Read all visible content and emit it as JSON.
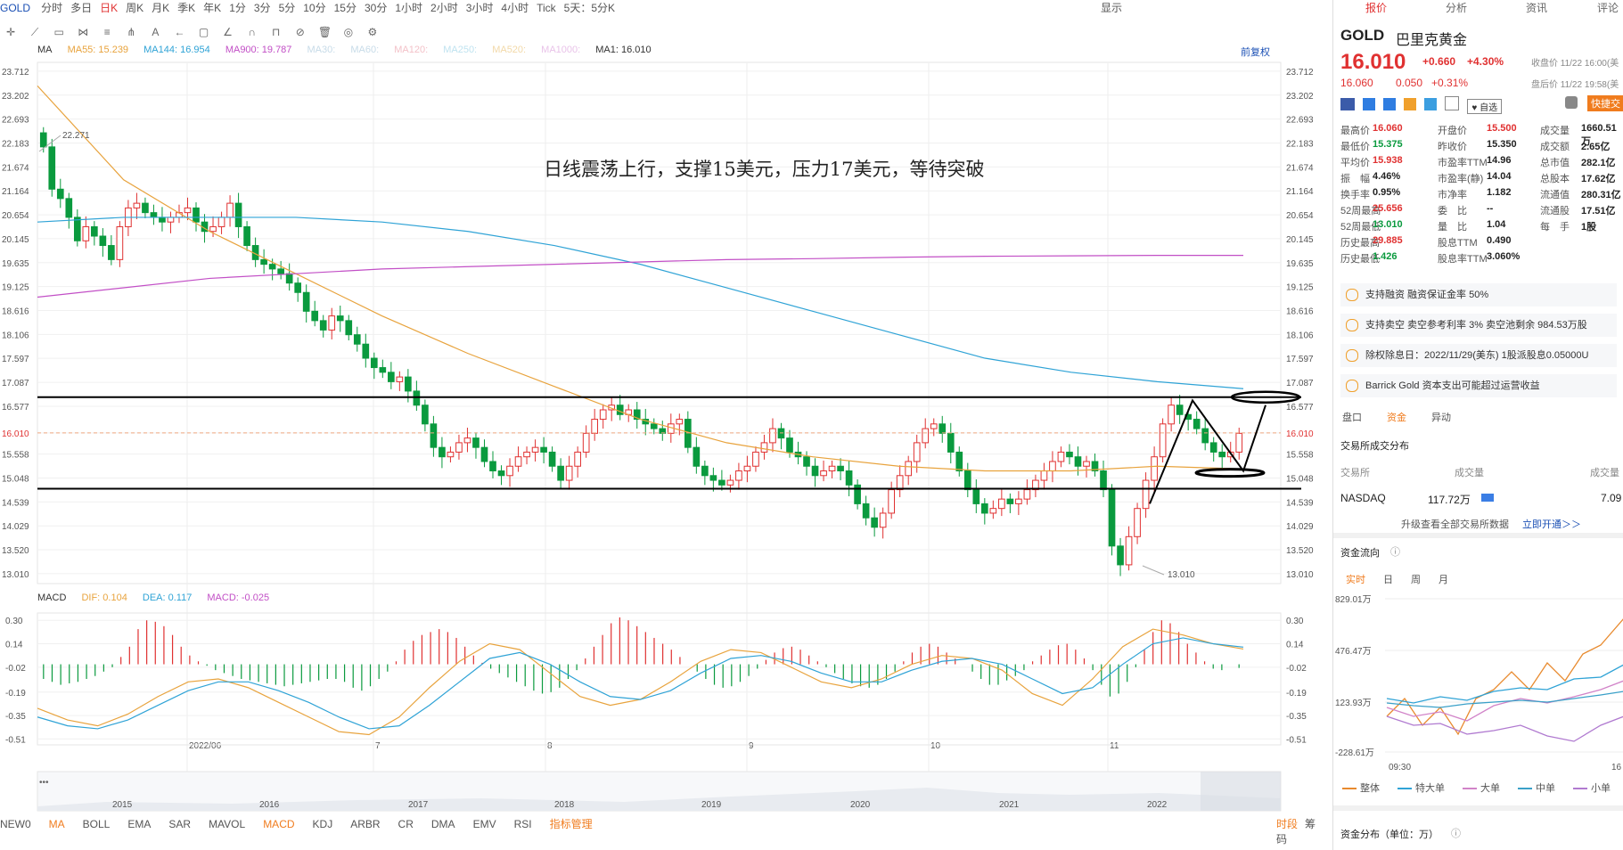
{
  "topbar": {
    "symbol": "GOLD",
    "periods": [
      "分时",
      "多日",
      "日K",
      "周K",
      "月K",
      "季K",
      "年K",
      "1分",
      "3分",
      "5分",
      "10分",
      "15分",
      "30分",
      "1小时",
      "2小时",
      "3小时",
      "4小时",
      "Tick",
      "5天：5分K"
    ],
    "active_period": "日K",
    "right_label": "显示"
  },
  "ma_legend": {
    "ma": "MA",
    "ma55": "MA55: 15.239",
    "ma144": "MA144: 16.954",
    "ma900": "MA900: 19.787",
    "ma30": "MA30:",
    "ma60": "MA60:",
    "ma120": "MA120:",
    "ma250": "MA250:",
    "ma520": "MA520:",
    "ma1000": "MA1000:",
    "ma1": "MA1: 16.010",
    "adjust": "前复权"
  },
  "macd_legend": {
    "name": "MACD",
    "dif": "DIF: 0.104",
    "dea": "DEA: 0.117",
    "macd": "MACD: -0.025"
  },
  "annotation": "日线震荡上行，支撑15美元，压力17美元，等待突破",
  "chart_data": [
    {
      "type": "line",
      "title": "",
      "price_ticks": [
        "23.712",
        "23.202",
        "22.693",
        "22.183",
        "21.674",
        "21.164",
        "20.654",
        "20.145",
        "19.635",
        "19.125",
        "18.616",
        "18.106",
        "17.597",
        "17.087",
        "16.577",
        "16.010",
        "15.558",
        "15.048",
        "14.539",
        "14.029",
        "13.520",
        "13.010"
      ],
      "ylim": [
        12.8,
        23.9
      ],
      "x_labels": [
        "2022/06",
        "7",
        "8",
        "9",
        "10",
        "11"
      ],
      "high_label": "22.271",
      "low_label": "13.010",
      "current_price": "16.010",
      "closes": [
        22.1,
        21.2,
        21.0,
        20.6,
        20.1,
        20.4,
        20.2,
        20.0,
        19.7,
        20.4,
        20.8,
        20.9,
        20.7,
        20.6,
        20.5,
        20.6,
        20.7,
        20.8,
        20.5,
        20.3,
        20.4,
        20.6,
        20.9,
        20.4,
        20.0,
        19.7,
        19.6,
        19.5,
        19.4,
        19.2,
        19.0,
        18.6,
        18.4,
        18.2,
        18.5,
        18.4,
        18.1,
        17.9,
        17.6,
        17.4,
        17.3,
        17.1,
        17.2,
        16.9,
        16.6,
        16.2,
        15.7,
        15.5,
        15.6,
        15.8,
        15.9,
        15.7,
        15.4,
        15.2,
        15.1,
        15.3,
        15.5,
        15.6,
        15.7,
        15.6,
        15.3,
        15.0,
        15.3,
        15.6,
        16.0,
        16.3,
        16.5,
        16.6,
        16.4,
        16.5,
        16.3,
        16.2,
        16.1,
        16.0,
        16.2,
        16.3,
        15.7,
        15.3,
        15.1,
        15.0,
        14.9,
        15.0,
        15.2,
        15.3,
        15.6,
        15.8,
        16.1,
        15.9,
        15.6,
        15.5,
        15.3,
        15.1,
        15.2,
        15.3,
        15.2,
        14.9,
        14.5,
        14.2,
        14.0,
        14.3,
        14.8,
        15.1,
        15.4,
        15.8,
        16.1,
        16.2,
        16.0,
        15.6,
        15.2,
        14.8,
        14.5,
        14.3,
        14.4,
        14.6,
        14.5,
        14.6,
        14.8,
        15.0,
        15.2,
        15.4,
        15.6,
        15.5,
        15.3,
        15.4,
        15.2,
        14.8,
        13.6,
        13.2,
        13.8,
        14.4,
        15.0,
        15.5,
        16.2,
        16.6,
        16.4,
        16.3,
        16.1,
        15.8,
        15.6,
        15.5,
        15.6,
        16.0
      ],
      "series": [
        {
          "name": "MA55",
          "values": [
            23.4,
            21.4,
            20.3,
            19.4,
            18.5,
            17.7,
            17.0,
            16.3,
            15.8,
            15.5,
            15.3,
            15.2,
            15.2,
            15.3,
            15.24
          ]
        },
        {
          "name": "MA144",
          "values": [
            20.5,
            20.6,
            20.6,
            20.6,
            20.5,
            20.3,
            20.0,
            19.6,
            19.1,
            18.6,
            18.1,
            17.6,
            17.3,
            17.1,
            16.95
          ]
        },
        {
          "name": "MA900",
          "values": [
            18.9,
            19.1,
            19.3,
            19.4,
            19.5,
            19.55,
            19.6,
            19.65,
            19.7,
            19.72,
            19.75,
            19.77,
            19.78,
            19.79,
            19.79
          ]
        }
      ]
    },
    {
      "type": "bar",
      "title": "",
      "ylim": [
        -0.55,
        0.35
      ],
      "y_ticks": [
        "0.30",
        "0.14",
        "-0.02",
        "-0.19",
        "-0.35",
        "-0.51"
      ],
      "macd_hist": [
        -0.1,
        -0.12,
        -0.14,
        -0.13,
        -0.12,
        -0.1,
        -0.08,
        -0.05,
        -0.02,
        0.05,
        0.12,
        0.24,
        0.3,
        0.29,
        0.26,
        0.2,
        0.12,
        0.06,
        0.02,
        -0.01,
        -0.04,
        -0.06,
        -0.08,
        -0.1,
        -0.11,
        -0.12,
        -0.13,
        -0.14,
        -0.15,
        -0.14,
        -0.13,
        -0.12,
        -0.11,
        -0.1,
        -0.1,
        -0.12,
        -0.16,
        -0.18,
        -0.15,
        -0.1,
        -0.05,
        0.02,
        0.1,
        0.16,
        0.2,
        0.22,
        0.24,
        0.22,
        0.18,
        0.12,
        0.06,
        0.01,
        -0.03,
        -0.06,
        -0.09,
        -0.12,
        -0.15,
        -0.18,
        -0.2,
        -0.19,
        -0.16,
        -0.1,
        -0.04,
        0.04,
        0.12,
        0.2,
        0.28,
        0.32,
        0.3,
        0.26,
        0.22,
        0.18,
        0.14,
        0.1,
        0.05,
        0.0,
        -0.05,
        -0.1,
        -0.14,
        -0.16,
        -0.15,
        -0.12,
        -0.08,
        -0.03,
        0.03,
        0.08,
        0.11,
        0.12,
        0.1,
        0.06,
        0.02,
        -0.02,
        -0.06,
        -0.1,
        -0.13,
        -0.15,
        -0.16,
        -0.14,
        -0.1,
        -0.05,
        0.02,
        0.08,
        0.12,
        0.14,
        0.12,
        0.08,
        0.04,
        0.0,
        -0.05,
        -0.1,
        -0.14,
        -0.14,
        -0.11,
        -0.08,
        -0.04,
        0.02,
        0.06,
        0.1,
        0.13,
        0.14,
        0.1,
        0.04,
        -0.04,
        -0.14,
        -0.22,
        -0.2,
        -0.12,
        -0.02,
        0.1,
        0.22,
        0.3,
        0.28,
        0.22,
        0.14,
        0.08,
        0.02,
        -0.03,
        -0.04,
        0.0,
        -0.025
      ],
      "series": [
        {
          "name": "DIF",
          "values": [
            -0.3,
            -0.38,
            -0.42,
            -0.34,
            -0.22,
            -0.12,
            -0.1,
            -0.16,
            -0.26,
            -0.36,
            -0.46,
            -0.48,
            -0.36,
            -0.16,
            0.02,
            0.14,
            0.1,
            -0.06,
            -0.22,
            -0.28,
            -0.24,
            -0.12,
            0.02,
            0.1,
            0.08,
            -0.02,
            -0.12,
            -0.16,
            -0.1,
            0.0,
            0.06,
            0.04,
            -0.04,
            -0.2,
            -0.28,
            -0.1,
            0.12,
            0.24,
            0.2,
            0.14,
            0.104
          ]
        },
        {
          "name": "DEA",
          "values": [
            -0.36,
            -0.42,
            -0.44,
            -0.38,
            -0.28,
            -0.18,
            -0.12,
            -0.12,
            -0.18,
            -0.26,
            -0.36,
            -0.44,
            -0.42,
            -0.28,
            -0.12,
            0.04,
            0.08,
            0.0,
            -0.12,
            -0.22,
            -0.24,
            -0.18,
            -0.06,
            0.04,
            0.06,
            0.02,
            -0.06,
            -0.12,
            -0.12,
            -0.04,
            0.02,
            0.04,
            0.0,
            -0.1,
            -0.2,
            -0.16,
            0.0,
            0.14,
            0.18,
            0.14,
            0.117
          ]
        }
      ]
    }
  ],
  "overview": {
    "years": [
      "2015",
      "2016",
      "2017",
      "2018",
      "2019",
      "2020",
      "2021",
      "2022"
    ]
  },
  "indicators": [
    "NEW0",
    "MA",
    "BOLL",
    "EMA",
    "SAR",
    "MAVOL",
    "MACD",
    "KDJ",
    "ARBR",
    "CR",
    "DMA",
    "EMV",
    "RSI",
    "指标管理"
  ],
  "indicator_active": "MACD",
  "indicators_right": [
    "时段",
    "筹码"
  ],
  "right_panel": {
    "tabs": [
      "报价",
      "分析",
      "资讯",
      "评论"
    ],
    "symbol": "GOLD",
    "name": "巴里克黄金",
    "price": "16.010",
    "change": "+0.660",
    "pct": "+4.30%",
    "close_time": "收盘价 11/22 16:00(美",
    "after_price": "16.060",
    "after_change": "0.050",
    "after_pct": "+0.31%",
    "after_time": "盘后价 11/22 19:58(美",
    "watch": "自选",
    "quick_trade": "快捷交",
    "stats": [
      [
        "最高价",
        "16.060",
        "开盘价",
        "15.500",
        "成交量",
        "1660.51万"
      ],
      [
        "最低价",
        "15.375",
        "昨收价",
        "15.350",
        "成交额",
        "2.65亿"
      ],
      [
        "平均价",
        "15.938",
        "市盈率TTM",
        "14.96",
        "总市值",
        "282.1亿"
      ],
      [
        "振　幅",
        "4.46%",
        "市盈率(静)",
        "14.04",
        "总股本",
        "17.62亿"
      ],
      [
        "换手率",
        "0.95%",
        "市净率",
        "1.182",
        "流通值",
        "280.31亿"
      ],
      [
        "52周最高",
        "25.656",
        "委　比",
        "--",
        "流通股",
        "17.51亿"
      ],
      [
        "52周最低",
        "13.010",
        "量　比",
        "1.04",
        "每　手",
        "1股"
      ],
      [
        "历史最高",
        "29.885",
        "股息TTM",
        "0.490",
        "",
        ""
      ],
      [
        "历史最低",
        "1.426",
        "股息率TTM",
        "3.060%",
        "",
        ""
      ]
    ],
    "notices": [
      "支持融资 融资保证金率 50%",
      "支持卖空 卖空参考利率 3% 卖空池剩余 984.53万股",
      "除权除息日：2022/11/29(美东) 1股派股息0.05000U",
      "Barrick Gold 资本支出可能超过运营收益"
    ],
    "subtabs": [
      "盘口",
      "资金",
      "异动"
    ],
    "dist_title": "交易所成交分布",
    "dist_headers": [
      "交易所",
      "成交量",
      "成交量"
    ],
    "dist_row": [
      "NASDAQ",
      "117.72万",
      "7.09"
    ],
    "upgrade": "升级查看全部交易所数据",
    "upgrade_link": "立即开通＞＞",
    "flow_title": "资金流向",
    "flow_tabs": [
      "实时",
      "日",
      "周",
      "月"
    ],
    "flow_y": [
      "829.01万",
      "476.47万",
      "123.93万",
      "-228.61万"
    ],
    "flow_x": [
      "09:30",
      "16"
    ],
    "flow_legend": [
      "整体",
      "特大单",
      "大单",
      "中单",
      "小单"
    ],
    "dist2_title": "资金分布（单位：万）"
  },
  "colors": {
    "up": "#e03131",
    "down": "#0a9a3e",
    "ma55": "#e8a33d",
    "ma144": "#2fa3d6",
    "ma900": "#c24fc6",
    "dif": "#e8a33d",
    "dea": "#2fa3d6"
  }
}
